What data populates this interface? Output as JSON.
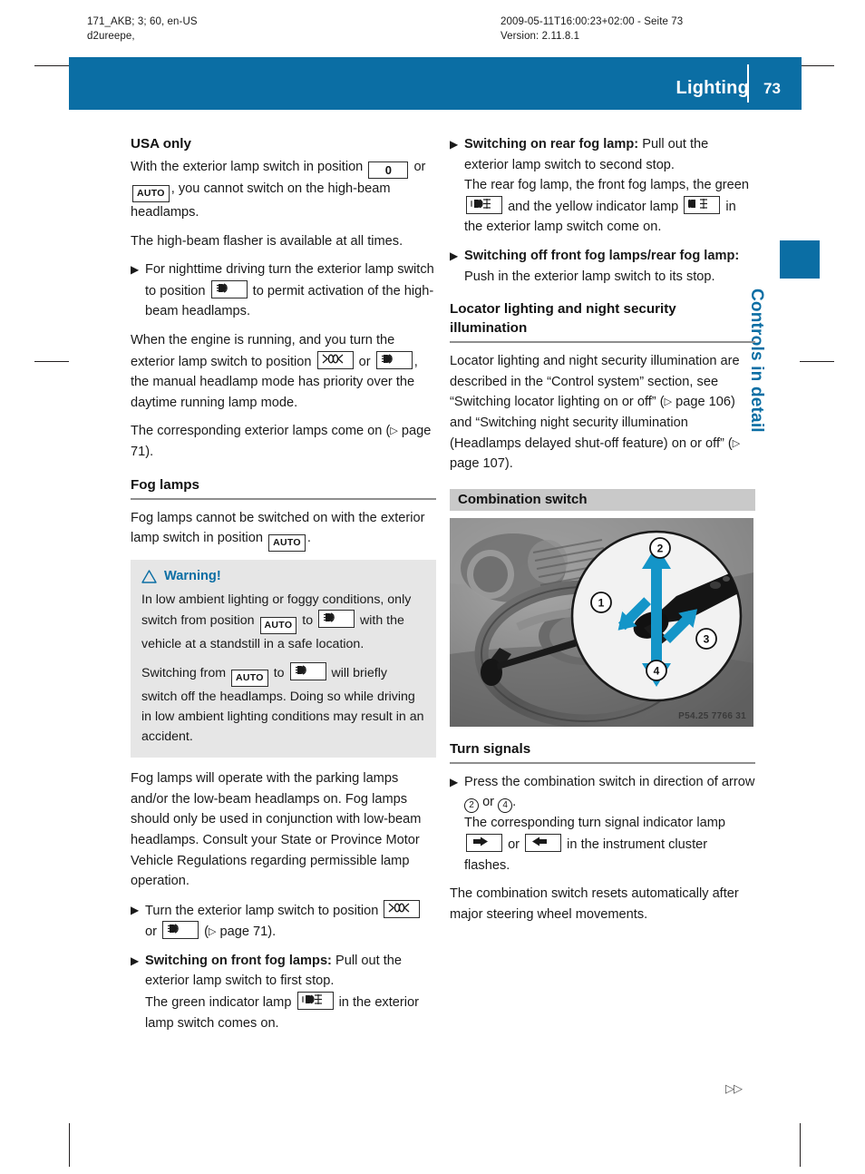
{
  "page": {
    "number": "73",
    "section_title": "Lighting",
    "thumb_tab": "Controls in detail",
    "bottom_marker": "▷▷",
    "colors": {
      "brand_blue": "#0b6ea4",
      "warn_gray": "#e6e6e6",
      "bar_gray": "#c9c9c9"
    }
  },
  "print_meta": {
    "left_line1": "171_AKB; 3; 60, en-US",
    "left_line2": "d2ureepe,",
    "right_line1": "2009-05-11T16:00:23+02:00 - Seite 73",
    "right_line2": "Version: 2.11.8.1"
  },
  "icons": {
    "off": "0",
    "auto": "AUTO",
    "headlamp": "headlamp-icon",
    "parking_lamp": "parking-lamp-icon",
    "front_fog": "front-fog-lamp-icon",
    "rear_fog": "rear-fog-lamp-icon",
    "turn_right": "turn-signal-right-icon",
    "turn_left": "turn-signal-left-icon"
  },
  "left_column": {
    "usa_heading": "USA only",
    "p1_a": "With the exterior lamp switch in position",
    "p1_b": "or",
    "p1_c": ", you cannot switch on the high-beam headlamps.",
    "p2": "The high-beam flasher is available at all times.",
    "b1_a": "For nighttime driving turn the exterior lamp switch to position",
    "b1_b": "to permit activation of the high-beam headlamps.",
    "p3_a": "When the engine is running, and you turn the exterior lamp switch to position",
    "p3_b": "or",
    "p3_c": ", the manual headlamp mode has priority over the daytime running lamp mode.",
    "p4_a": "The corresponding exterior lamps come on (",
    "p4_b": "page 71).",
    "fog_heading": "Fog lamps",
    "p5_a": "Fog lamps cannot be switched on with the exterior lamp switch in position",
    "p5_b": ".",
    "warning": {
      "title": "Warning!",
      "icon": "warning-triangle-icon",
      "w1_a": "In low ambient lighting or foggy conditions, only switch from position",
      "w1_b": "to",
      "w1_c": "with the vehicle at a standstill in a safe location.",
      "w2_a": "Switching from",
      "w2_b": "to",
      "w2_c": "will briefly switch off the headlamps. Doing so while driving in low ambient lighting conditions may result in an accident."
    },
    "p6": "Fog lamps will operate with the parking lamps and/or the low-beam headlamps on. Fog lamps should only be used in conjunction with low-beam headlamps. Consult your State or Province Motor Vehicle Regulations regarding permissible lamp operation.",
    "b2_a": "Turn the exterior lamp switch to position",
    "b2_b": "or",
    "b2_c": "(",
    "b2_d": "page 71).",
    "b3_lead": "Switching on front fog lamps:",
    "b3_a": "Pull out the exterior lamp switch to first stop.",
    "b3_b": "The green indicator lamp",
    "b3_c": "in the exterior lamp switch comes on."
  },
  "right_column": {
    "b4_lead": "Switching on rear fog lamp:",
    "b4_a": "Pull out the exterior lamp switch to second stop.",
    "b4_b": "The rear fog lamp, the front fog lamps, the green",
    "b4_c": "and the yellow indicator lamp",
    "b4_d": "in the exterior lamp switch come on.",
    "b5_lead": "Switching off front fog lamps/rear fog lamp:",
    "b5_a": "Push in the exterior lamp switch to its stop.",
    "locator_heading": "Locator lighting and night security illumination",
    "p7_a": "Locator lighting and night security illumination are described in the “Control system” section, see “Switching locator lighting on or off” (",
    "p7_b": "page 106) and “Switching night security illumination (Headlamps delayed shut-off feature) on or off” (",
    "p7_c": "page 107).",
    "combo_heading": "Combination switch",
    "figure": {
      "caption": "P54.25 7766 31",
      "alt": "Steering wheel with combination switch, magnified callout showing four directions",
      "callouts": [
        "1",
        "2",
        "3",
        "4"
      ]
    },
    "turn_heading": "Turn signals",
    "b6_a": "Press the combination switch in direction of arrow",
    "b6_or": "or",
    "b6_end": ".",
    "b6_b": "The corresponding turn signal indicator lamp",
    "b6_c": "or",
    "b6_d": "in the instrument cluster flashes.",
    "p8": "The combination switch resets automatically after major steering wheel movements."
  }
}
